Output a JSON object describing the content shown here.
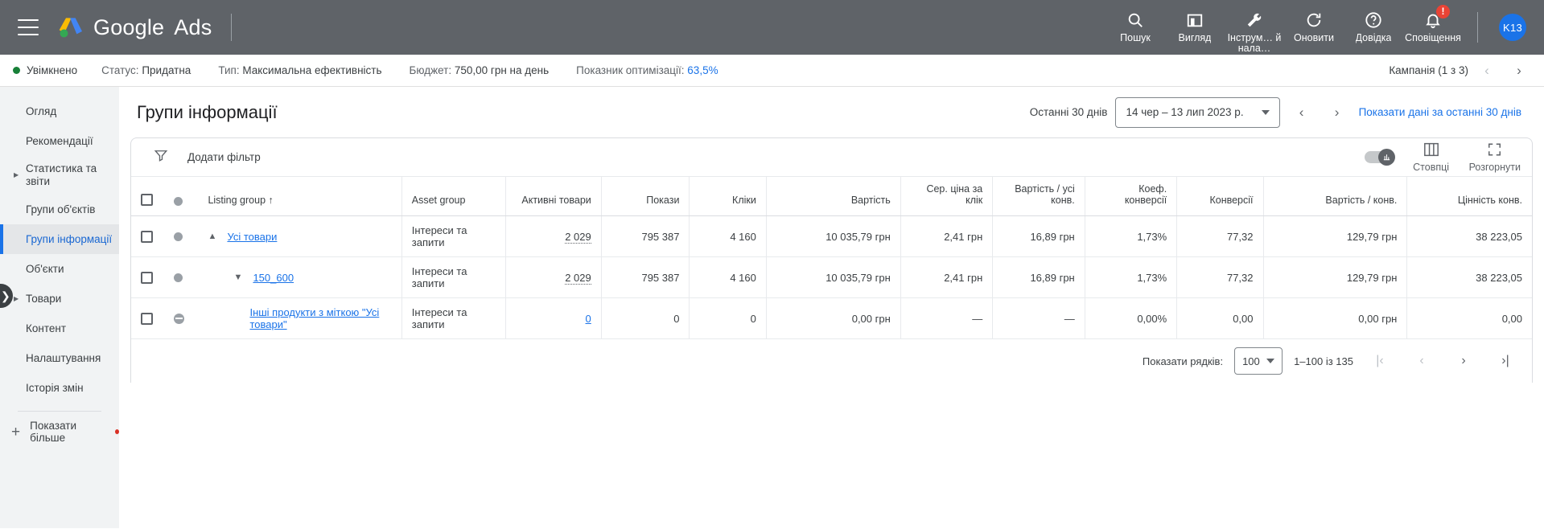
{
  "header": {
    "brand_google": "Google",
    "brand_ads": "Ads",
    "nav": [
      {
        "label": "Пошук",
        "icon": "search-icon"
      },
      {
        "label": "Вигляд",
        "icon": "view-icon"
      },
      {
        "label": "Інструм…\nй нала…",
        "icon": "tools-icon"
      },
      {
        "label": "Оновити",
        "icon": "refresh-icon"
      },
      {
        "label": "Довідка",
        "icon": "help-icon"
      },
      {
        "label": "Сповіщення",
        "icon": "bell-icon",
        "badge": "!"
      }
    ],
    "avatar_initials": "K13"
  },
  "status": {
    "state": "Увімкнено",
    "status_label": "Статус:",
    "status_value": "Придатна",
    "type_label": "Тип:",
    "type_value": "Максимальна ефективність",
    "budget_label": "Бюджет:",
    "budget_value": "750,00 грн на день",
    "optscore_label": "Показник оптимізації:",
    "optscore_value": "63,5%",
    "campaign_counter": "Кампанія (1 з 3)"
  },
  "sidebar": {
    "items": [
      {
        "label": "Огляд",
        "expandable": false,
        "active": false
      },
      {
        "label": "Рекомендації",
        "expandable": false,
        "active": false
      },
      {
        "label": "Статистика та звіти",
        "expandable": true,
        "active": false
      },
      {
        "label": "Групи об'єктів",
        "expandable": false,
        "active": false
      },
      {
        "label": "Групи інформації",
        "expandable": false,
        "active": true
      },
      {
        "label": "Об'єкти",
        "expandable": false,
        "active": false
      },
      {
        "label": "Товари",
        "expandable": true,
        "active": false
      },
      {
        "label": "Контент",
        "expandable": false,
        "active": false
      },
      {
        "label": "Налаштування",
        "expandable": false,
        "active": false
      },
      {
        "label": "Історія змін",
        "expandable": false,
        "active": false
      }
    ],
    "show_more": "Показати більше"
  },
  "page": {
    "title": "Групи інформації",
    "date_prefix": "Останні 30 днів",
    "date_range": "14 чер – 13 лип 2023 р.",
    "show_last_30": "Показати дані за останні 30 днів"
  },
  "toolbar": {
    "add_filter": "Додати фільтр",
    "columns_label": "Стовпці",
    "expand_label": "Розгорнути"
  },
  "table": {
    "columns": [
      {
        "key": "listing_group",
        "label": "Listing group",
        "align": "left",
        "sorted": true,
        "sort_arrow": "↑"
      },
      {
        "key": "asset_group",
        "label": "Asset group",
        "align": "left"
      },
      {
        "key": "active_products",
        "label": "Активні товари",
        "align": "right"
      },
      {
        "key": "impressions",
        "label": "Покази",
        "align": "right"
      },
      {
        "key": "clicks",
        "label": "Кліки",
        "align": "right"
      },
      {
        "key": "cost",
        "label": "Вартість",
        "align": "right"
      },
      {
        "key": "avg_cpc",
        "label": "Сер. ціна за клік",
        "align": "right"
      },
      {
        "key": "cost_per_conv",
        "label": "Вартість / усі конв.",
        "align": "right"
      },
      {
        "key": "conv_rate",
        "label": "Коеф. конверсії",
        "align": "right"
      },
      {
        "key": "conversions",
        "label": "Конверсії",
        "align": "right"
      },
      {
        "key": "cost_per_conversion",
        "label": "Вартість / конв.",
        "align": "right"
      },
      {
        "key": "conv_value",
        "label": "Цінність конв.",
        "align": "right"
      }
    ],
    "rows": [
      {
        "expander": "▲",
        "indent": 1,
        "status_icon": "circle-icon",
        "listing_group": "Усі товари",
        "listing_group_link": true,
        "asset_group": "Інтереси та запити",
        "active_products": "2 029",
        "active_products_dashed": true,
        "impressions": "795 387",
        "clicks": "4 160",
        "cost": "10 035,79 грн",
        "avg_cpc": "2,41 грн",
        "cost_per_conv": "16,89 грн",
        "conv_rate": "1,73%",
        "conversions": "77,32",
        "cost_per_conversion": "129,79 грн",
        "conv_value": "38 223,05"
      },
      {
        "expander": "▼",
        "indent": 2,
        "status_icon": "circle-icon",
        "listing_group": "150_600",
        "listing_group_link": true,
        "asset_group": "Інтереси та запити",
        "active_products": "2 029",
        "active_products_dashed": true,
        "impressions": "795 387",
        "clicks": "4 160",
        "cost": "10 035,79 грн",
        "avg_cpc": "2,41 грн",
        "cost_per_conv": "16,89 грн",
        "conv_rate": "1,73%",
        "conversions": "77,32",
        "cost_per_conversion": "129,79 грн",
        "conv_value": "38 223,05"
      },
      {
        "expander": "",
        "indent": 3,
        "status_icon": "minus-circle-icon",
        "listing_group": "Інші продукти з міткою \"Усі товари\"",
        "listing_group_link": true,
        "asset_group": "Інтереси та запити",
        "active_products": "0",
        "active_products_dashed": false,
        "impressions": "0",
        "clicks": "0",
        "cost": "0,00 грн",
        "avg_cpc": "—",
        "cost_per_conv": "—",
        "conv_rate": "0,00%",
        "conversions": "0,00",
        "cost_per_conversion": "0,00 грн",
        "conv_value": "0,00"
      }
    ]
  },
  "pagination": {
    "rows_label": "Показати рядків:",
    "rows_value": "100",
    "range": "1–100 із 135"
  },
  "colors": {
    "brand_blue": "#1a73e8",
    "topbar_gray": "#5f6368",
    "sidebar_bg": "#f1f3f4",
    "status_green": "#188038",
    "badge_red": "#ea4335"
  }
}
